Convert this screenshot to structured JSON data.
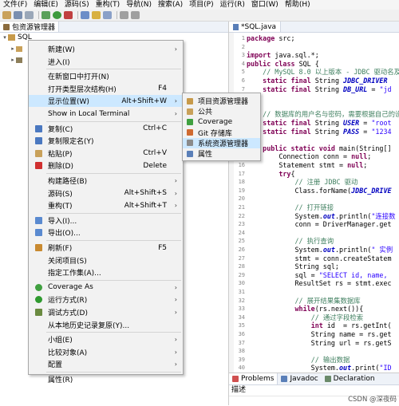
{
  "menubar": [
    "文件(F)",
    "编辑(E)",
    "源码(S)",
    "重构(T)",
    "导航(N)",
    "搜索(A)",
    "项目(P)",
    "运行(R)",
    "窗口(W)",
    "帮助(H)"
  ],
  "left_panel": {
    "tab_label": "包资源管理器",
    "project_name": "SQL"
  },
  "editor": {
    "tab_label": "*SQL.java",
    "lines": [
      "package src;",
      "",
      "import java.sql.*;",
      "public class SQL {",
      "    // MySQL 8.0 以上版本 - JDBC 驱动名及数",
      "    static final String JDBC_DRIVER",
      "    static final String DB_URL = \"jd",
      "",
      "",
      "    // 数据库的用户名与密码，需要根据自己的设置",
      "    static final String USER = \"root",
      "    static final String PASS = \"1234",
      "",
      "    public static void main(String[]",
      "        Connection conn = null;",
      "        Statement stmt = null;",
      "        try{",
      "            // 注册 JDBC 驱动",
      "            Class.forName(JDBC_DRIVE",
      "",
      "            // 打开链接",
      "            System.out.println(\"连接数",
      "            conn = DriverManager.get",
      "",
      "            // 执行查询",
      "            System.out.println(\" 实例",
      "            stmt = conn.createStatem",
      "            String sql;",
      "            sql = \"SELECT id, name,",
      "            ResultSet rs = stmt.exec",
      "",
      "            // 展开结果集数据库",
      "            while(rs.next()){",
      "                // 通过字段检索",
      "                int id  = rs.getInt(",
      "                String name = rs.get",
      "                String url = rs.getS",
      "",
      "                // 输出数据",
      "                System.out.print(\"ID",
      "                System.out.print(\""
    ]
  },
  "context_menu": {
    "items": [
      {
        "label": "新建(W)",
        "arrow": true,
        "icon": "none"
      },
      {
        "label": "进入(I)",
        "icon": "none"
      },
      {
        "label": "在新窗口中打开(N)",
        "icon": "none"
      },
      {
        "label": "打开类型层次结构(H)",
        "shortcut": "F4",
        "icon": "none"
      },
      {
        "label": "显示位置(W)",
        "shortcut": "Alt+Shift+W",
        "arrow": true,
        "icon": "none",
        "highlighted": true
      },
      {
        "label": "Show in Local Terminal",
        "arrow": true,
        "icon": "none"
      },
      {
        "label": "复制(C)",
        "shortcut": "Ctrl+C",
        "icon": "copy-icon"
      },
      {
        "label": "复制限定名(Y)",
        "icon": "copy-qualified-icon"
      },
      {
        "label": "粘贴(P)",
        "shortcut": "Ctrl+V",
        "icon": "paste-icon"
      },
      {
        "label": "删除(D)",
        "shortcut": "Delete",
        "icon": "delete-icon"
      },
      {
        "label": "构建路径(B)",
        "arrow": true,
        "icon": "none"
      },
      {
        "label": "源码(S)",
        "shortcut": "Alt+Shift+S",
        "arrow": true,
        "icon": "none"
      },
      {
        "label": "重构(T)",
        "shortcut": "Alt+Shift+T",
        "arrow": true,
        "icon": "none"
      },
      {
        "label": "导入(I)...",
        "icon": "import-icon"
      },
      {
        "label": "导出(O)...",
        "icon": "export-icon"
      },
      {
        "label": "刷新(F)",
        "shortcut": "F5",
        "icon": "refresh-icon"
      },
      {
        "label": "关闭项目(S)",
        "icon": "none"
      },
      {
        "label": "指定工作集(A)...",
        "icon": "none"
      },
      {
        "label": "Coverage As",
        "arrow": true,
        "icon": "coverage-icon"
      },
      {
        "label": "运行方式(R)",
        "arrow": true,
        "icon": "run-icon"
      },
      {
        "label": "调试方式(D)",
        "arrow": true,
        "icon": "debug-icon"
      },
      {
        "label": "从本地历史记录复原(Y)...",
        "icon": "none"
      },
      {
        "label": "小组(E)",
        "arrow": true,
        "icon": "none"
      },
      {
        "label": "比较对象(A)",
        "arrow": true,
        "icon": "none"
      },
      {
        "label": "配置",
        "arrow": true,
        "icon": "none"
      },
      {
        "label": "属性(R)",
        "icon": "none"
      }
    ]
  },
  "submenu": {
    "items": [
      {
        "label": "项目资源管理器",
        "icon": "project-explorer-icon"
      },
      {
        "label": "公共",
        "icon": "common-icon"
      },
      {
        "label": "Coverage",
        "icon": "coverage-icon"
      },
      {
        "label": "Git 存储库",
        "icon": "git-repo-icon"
      },
      {
        "label": "系统资源管理器",
        "icon": "system-explorer-icon",
        "highlighted": true
      },
      {
        "label": "属性",
        "icon": "properties-icon"
      }
    ]
  },
  "bottom_panel": {
    "tabs": [
      "Problems",
      "Javadoc",
      "Declaration"
    ],
    "description_label": "描述",
    "watermark": "CSDN @深夜码"
  }
}
